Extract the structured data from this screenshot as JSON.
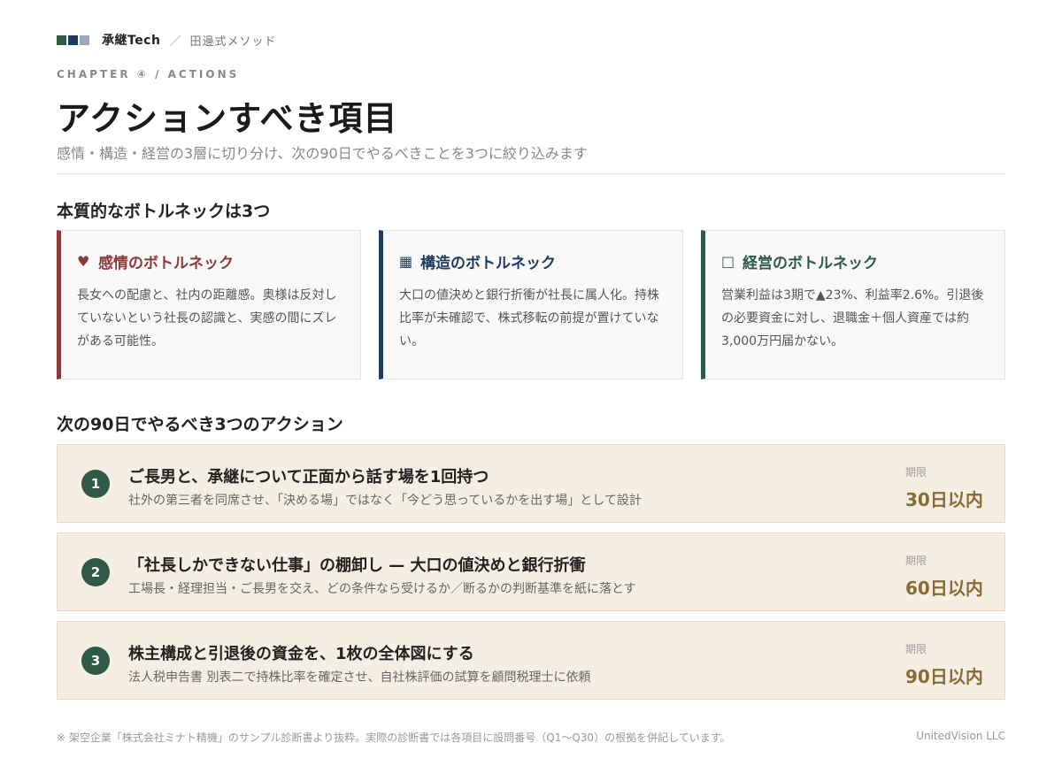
{
  "header": {
    "brand": "承継Tech",
    "separator": "／",
    "method": "田邊式メソッド",
    "brand_colors": [
      "#2f5a47",
      "#1f3a5f",
      "#9aa8bd"
    ]
  },
  "chapter": "CHAPTER ④  /  ACTIONS",
  "title": "アクションすべき項目",
  "subtitle": "感情・構造・経営の3層に切り分け、次の90日でやるべきことを3つに絞り込みます",
  "bottlenecks": {
    "section_title": "本質的なボトルネックは3つ",
    "cards": [
      {
        "icon": "heart-icon",
        "glyph": "♥",
        "color": "#8b3a3a",
        "label": "感情のボトルネック",
        "body": "長女への配慮と、社内の距離感。奥様は反対していないという社長の認識と、実感の間にズレがある可能性。"
      },
      {
        "icon": "grid-icon",
        "glyph": "▦",
        "color": "#1f3a5f",
        "label": "構造のボトルネック",
        "body": "大口の値決めと銀行折衝が社長に属人化。持株比率が未確認で、株式移転の前提が置けていない。"
      },
      {
        "icon": "square-icon",
        "glyph": "□",
        "color": "#2f5a47",
        "label": "経営のボトルネック",
        "body": "営業利益は3期で▲23%、利益率2.6%。引退後の必要資金に対し、退職金＋個人資産では約3,000万円届かない。"
      }
    ]
  },
  "actions": {
    "section_title": "次の90日でやるべき3つのアクション",
    "deadline_label": "期限",
    "items": [
      {
        "number": "1",
        "title": "ご長男と、承継について正面から話す場を1回持つ",
        "description": "社外の第三者を同席させ、「決める場」ではなく「今どう思っているかを出す場」として設計",
        "deadline": "30日以内"
      },
      {
        "number": "2",
        "title": "「社長しかできない仕事」の棚卸し — 大口の値決めと銀行折衝",
        "description": "工場長・経理担当・ご長男を交え、どの条件なら受けるか／断るかの判断基準を紙に落とす",
        "deadline": "60日以内"
      },
      {
        "number": "3",
        "title": "株主構成と引退後の資金を、1枚の全体図にする",
        "description": "法人税申告書 別表二で持株比率を確定させ、自社株評価の試算を顧問税理士に依頼",
        "deadline": "90日以内"
      }
    ]
  },
  "footer": {
    "note": "※ 架空企業「株式会社ミナト精機」のサンプル診断書より抜粋。実際の診断書では各項目に設問番号（Q1〜Q30）の根拠を併記しています。",
    "company": "UnitedVision LLC"
  }
}
